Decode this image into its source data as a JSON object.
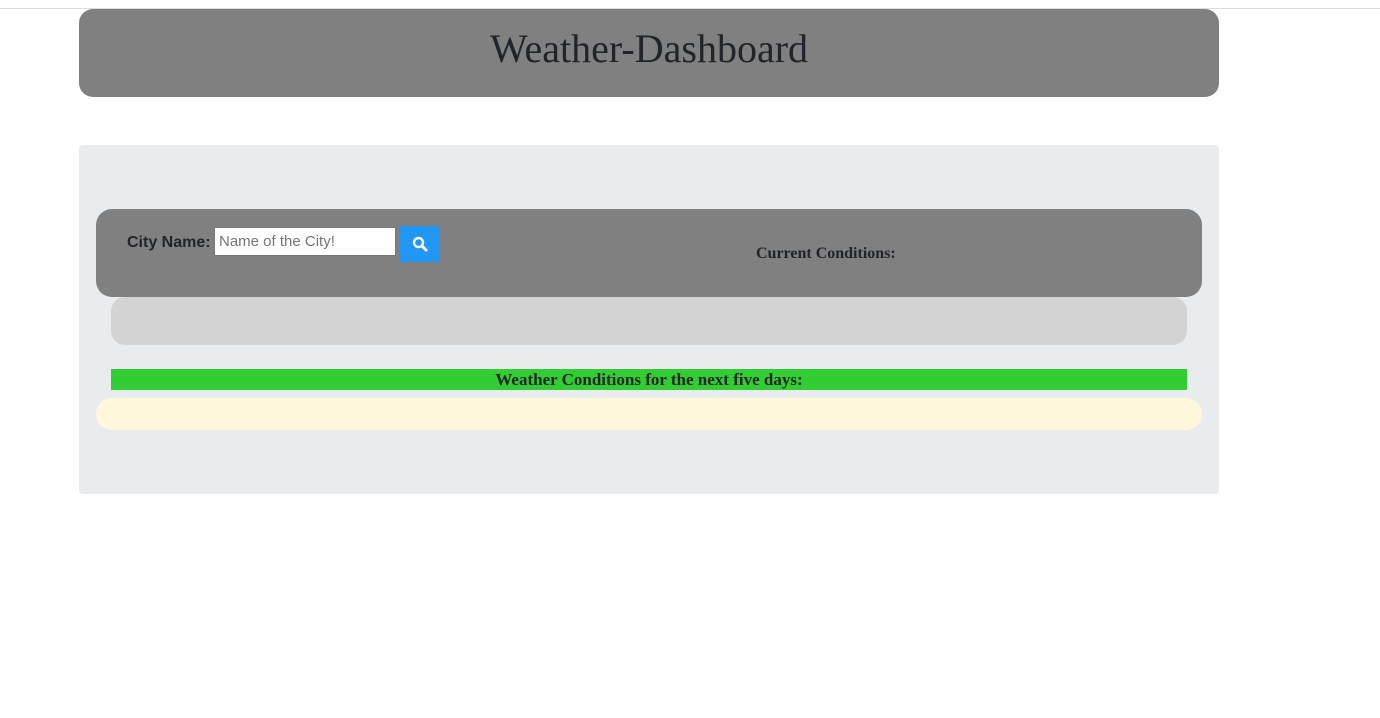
{
  "header": {
    "title": "Weather-Dashboard"
  },
  "search": {
    "label": "City Name:",
    "placeholder": "Name of the City!",
    "value": "",
    "button_icon": "search-icon"
  },
  "current": {
    "label": "Current Conditions:"
  },
  "forecast": {
    "label": "Weather Conditions for the next five days:"
  },
  "colors": {
    "header_bg": "#808080",
    "jumbotron_bg": "#e9ecef",
    "search_button": "#2196f3",
    "current_panel": "#d3d3d3",
    "forecast_banner": "#32cd32",
    "forecast_panel": "#fff8dc"
  }
}
